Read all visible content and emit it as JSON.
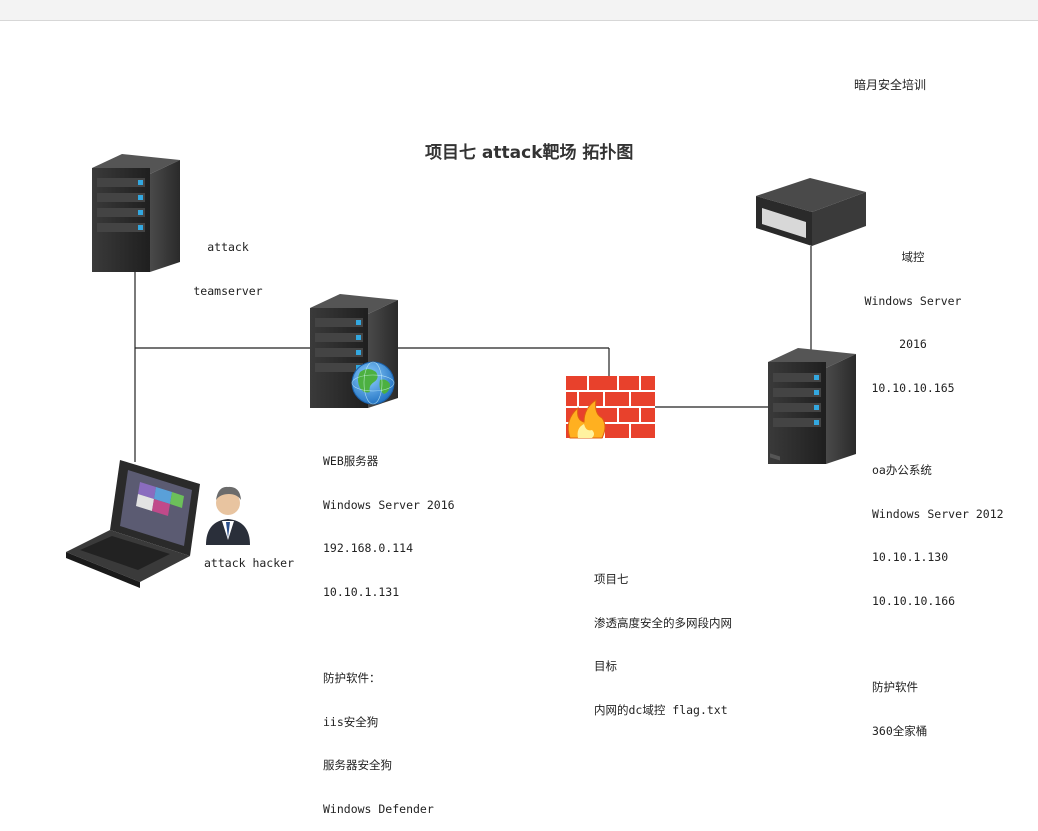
{
  "brand": "暗月安全培训",
  "title": "项目七 attack靶场 拓扑图",
  "nodes": {
    "teamserver": {
      "lines": [
        "attack",
        "teamserver"
      ]
    },
    "hacker": {
      "label": "attack hacker"
    },
    "web": {
      "lines": [
        "WEB服务器",
        "Windows Server 2016",
        "192.168.0.114",
        "10.10.1.131"
      ],
      "protect_title": "防护软件：",
      "protect_items": [
        "iis安全狗",
        "服务器安全狗",
        "Windows Defender"
      ]
    },
    "dc": {
      "lines": [
        "域控",
        "Windows Server",
        "2016",
        "10.10.10.165"
      ]
    },
    "oa": {
      "lines": [
        "oa办公系统",
        "Windows Server 2012",
        "10.10.1.130",
        "10.10.10.166"
      ],
      "protect_title": "防护软件",
      "protect_items": [
        "360全家桶"
      ]
    }
  },
  "goal": {
    "lines": [
      "项目七",
      "渗透高度安全的多网段内网",
      "目标",
      "内网的dc域控 flag.txt"
    ]
  },
  "colors": {
    "server_body": "#2f2f2f",
    "server_led": "#33a8e0",
    "firewall": "#e8412c",
    "line": "#222222"
  }
}
